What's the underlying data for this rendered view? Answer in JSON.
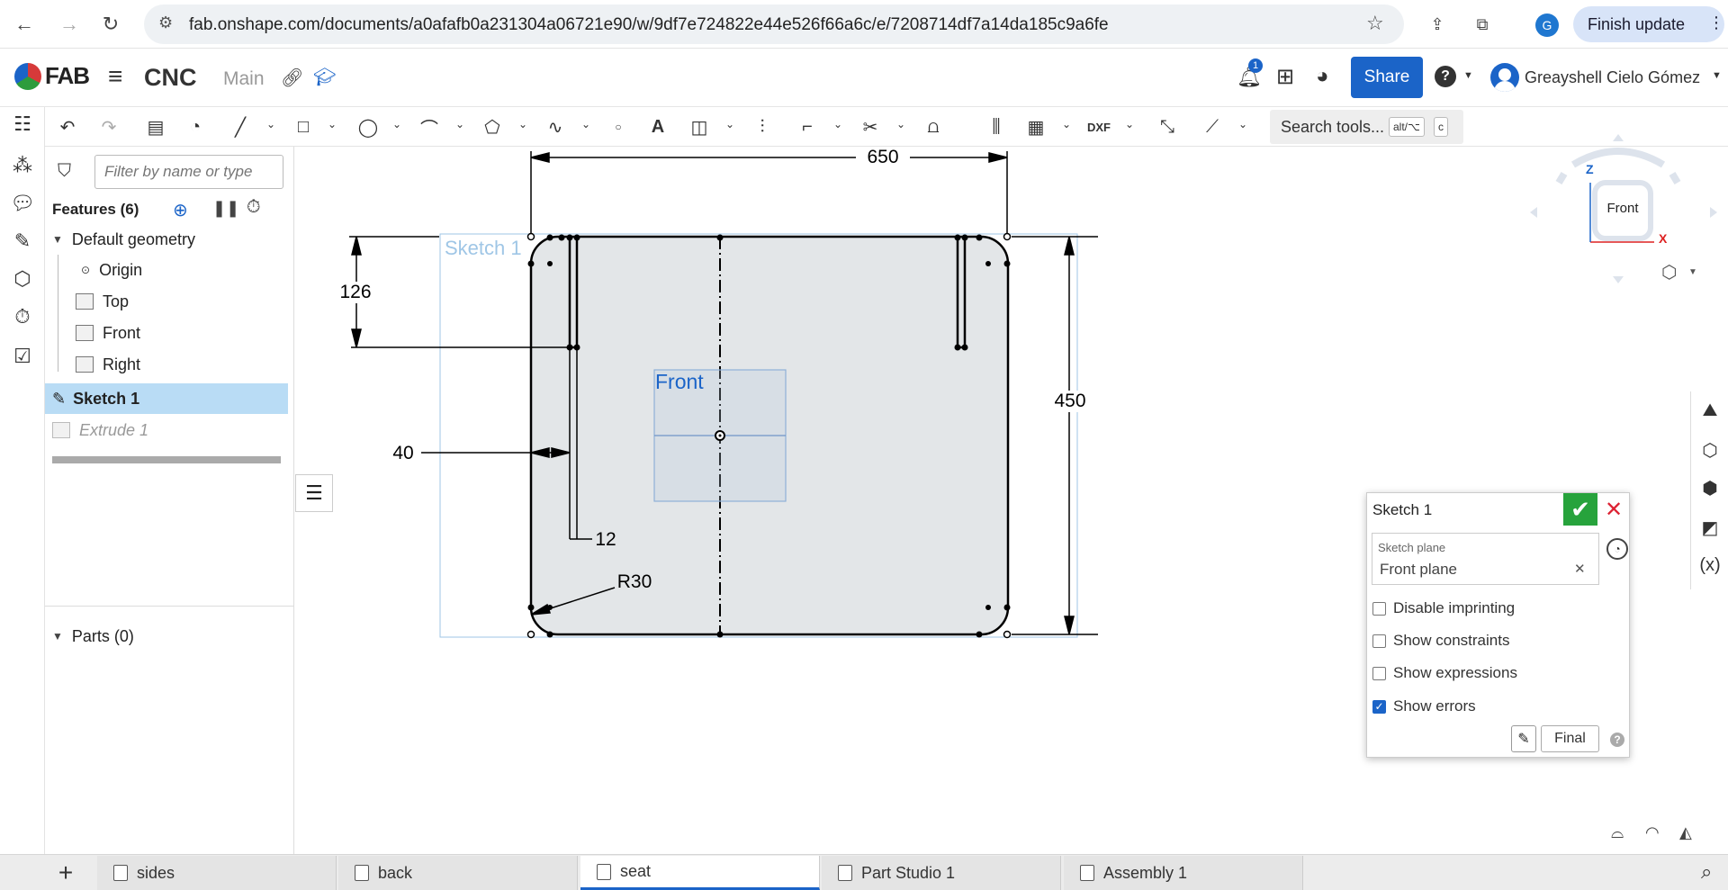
{
  "browser": {
    "url": "fab.onshape.com/documents/a0afafb0a231304a06721e90/w/9df7e724822e44e526f66a6c/e/7208714df7a14da185c9a6fe",
    "profile_initial": "G",
    "finish_update_label": "Finish update"
  },
  "header": {
    "logo": "FAB",
    "doc_title": "CNC",
    "branch": "Main",
    "notification_count": "1",
    "share_label": "Share",
    "help_label": "?",
    "user_name": "Greayshell Cielo Gómez"
  },
  "toolbar": {
    "search_placeholder": "Search tools...",
    "shortcut_mod": "alt/⌥",
    "shortcut_key": "c"
  },
  "feature_panel": {
    "filter_placeholder": "Filter by name or type",
    "features_header": "Features (6)",
    "default_geometry_label": "Default geometry",
    "items": [
      {
        "label": "Origin"
      },
      {
        "label": "Top"
      },
      {
        "label": "Front"
      },
      {
        "label": "Right"
      },
      {
        "label": "Sketch 1"
      },
      {
        "label": "Extrude 1"
      }
    ],
    "parts_header": "Parts (0)"
  },
  "canvas": {
    "sketch_label": "Sketch 1",
    "plane_label": "Front",
    "dimensions": {
      "width": "650",
      "height": "450",
      "slot_depth": "126",
      "slot_offset": "40",
      "slot_width": "12",
      "fillet_radius": "R30"
    },
    "view_cube": {
      "face_label": "Front",
      "axis_z": "Z",
      "axis_x": "X"
    }
  },
  "sketch_dialog": {
    "title": "Sketch 1",
    "sketch_plane_label": "Sketch plane",
    "sketch_plane_value": "Front plane",
    "options": [
      {
        "label": "Disable imprinting",
        "checked": false
      },
      {
        "label": "Show constraints",
        "checked": false
      },
      {
        "label": "Show expressions",
        "checked": false
      },
      {
        "label": "Show errors",
        "checked": true
      }
    ],
    "final_label": "Final"
  },
  "bottom_tabs": {
    "add_label": "+",
    "tabs": [
      {
        "label": "sides",
        "active": false
      },
      {
        "label": "back",
        "active": false
      },
      {
        "label": "seat",
        "active": true
      },
      {
        "label": "Part Studio 1",
        "active": false
      },
      {
        "label": "Assembly 1",
        "active": false
      }
    ]
  },
  "colors": {
    "accent": "#1b64c8",
    "accept": "#27a33c",
    "cancel": "#d22233",
    "selection": "#b9dcf5",
    "sketch_fill": "#e3e6e8"
  }
}
